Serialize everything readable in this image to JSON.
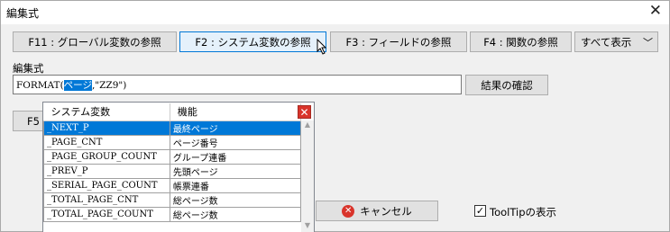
{
  "window": {
    "title": "編集式"
  },
  "toolbar": {
    "f11_label": "F11 : グローバル変数の参照",
    "f2_label": "F2 : システム変数の参照",
    "f3_label": "F3 : フィールドの参照",
    "f4_label": "F4 : 関数の参照",
    "display_select_value": "すべて表示"
  },
  "expression": {
    "label": "編集式",
    "prefix": "FORMAT(",
    "selected": "ページ",
    "suffix": ",\"ZZ9\")",
    "check_button": "結果の確認"
  },
  "f5_partial": "F5",
  "popup": {
    "columns": [
      "システム変数",
      "機能"
    ],
    "rows": [
      {
        "name": "_NEXT_P",
        "desc": "最終ページ"
      },
      {
        "name": "_PAGE_CNT",
        "desc": "ページ番号"
      },
      {
        "name": "_PAGE_GROUP_COUNT",
        "desc": "グループ連番"
      },
      {
        "name": "_PREV_P",
        "desc": "先頭ページ"
      },
      {
        "name": "_SERIAL_PAGE_COUNT",
        "desc": "帳票連番"
      },
      {
        "name": "_TOTAL_PAGE_CNT",
        "desc": "総ページ数"
      },
      {
        "name": "_TOTAL_PAGE_COUNT",
        "desc": "総ページ数"
      }
    ],
    "selected_row": 0
  },
  "footer": {
    "cancel_label": "キャンセル",
    "tooltip_label": "ToolTipの表示",
    "tooltip_checked": true
  }
}
